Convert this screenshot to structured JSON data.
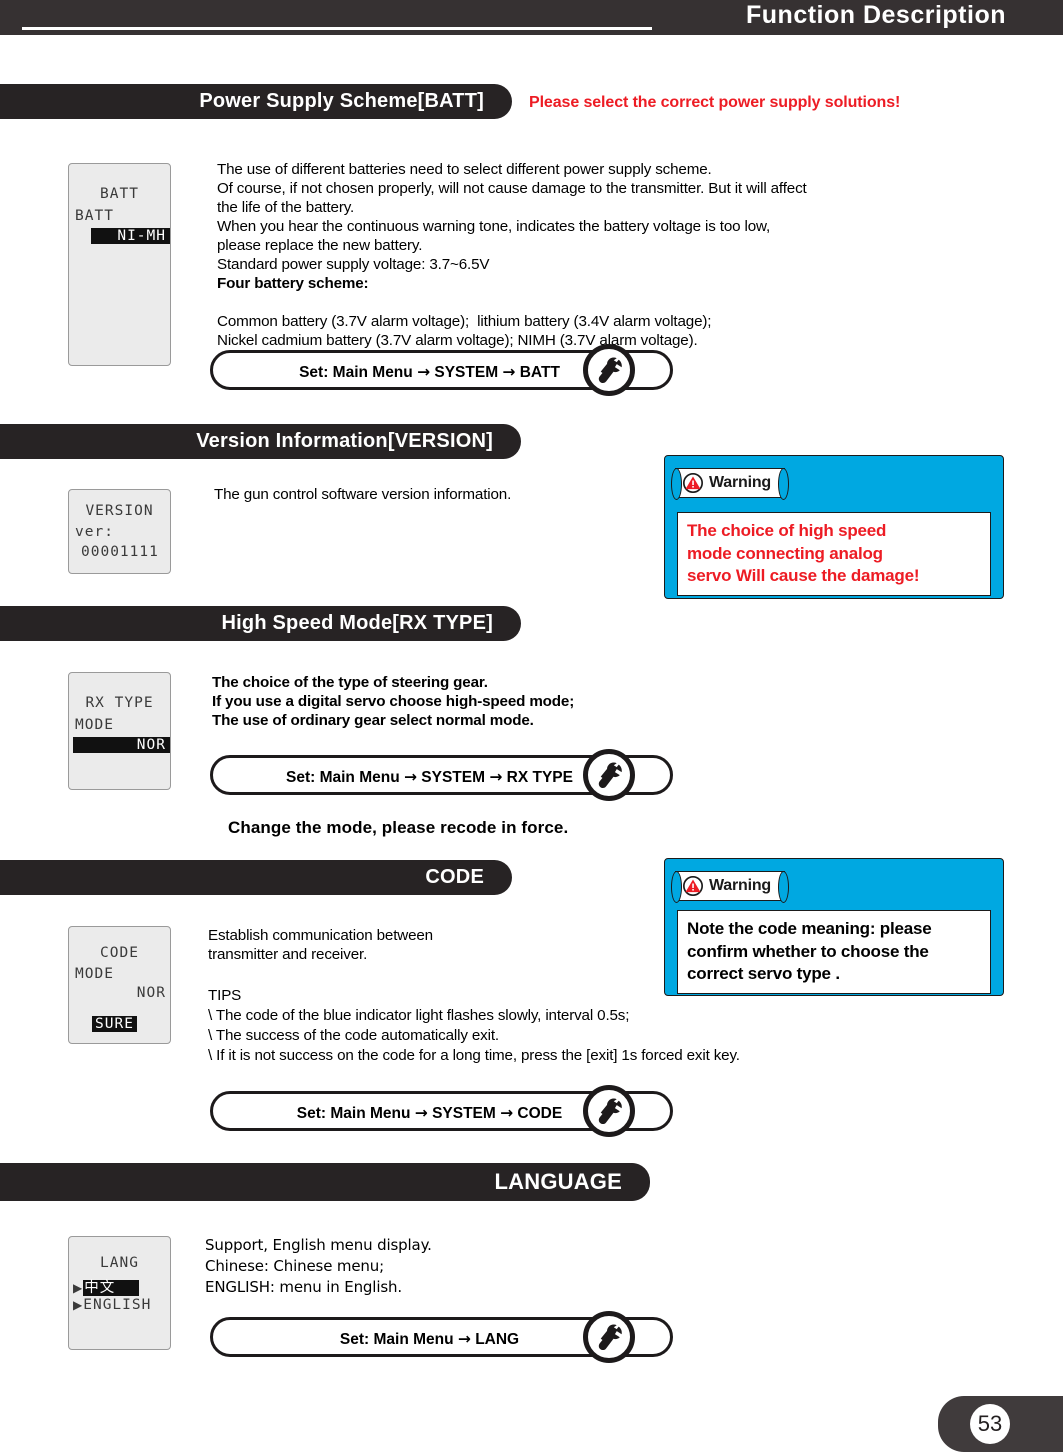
{
  "header": {
    "title": "Function Description"
  },
  "sections": {
    "batt": {
      "bar_label": "Power Supply Scheme[BATT]",
      "bar_note": "Please select the correct power supply solutions!",
      "lcd": {
        "title": "BATT",
        "line1": "BATT",
        "value": "NI-MH"
      },
      "body": [
        "The use of different batteries need to select different power supply scheme.",
        "Of course, if not chosen properly, will not cause damage to the transmitter. But it will affect",
        "the life of the battery.",
        "When you hear the continuous warning tone, indicates the battery voltage is too low,",
        "please replace the new battery.",
        "Standard power supply voltage: 3.7~6.5V"
      ],
      "body_bold": "Four battery scheme:",
      "body_tail": [
        "Common battery (3.7V alarm voltage);  lithium battery (3.4V alarm voltage);",
        "Nickel cadmium battery (3.7V alarm voltage); NIMH (3.7V alarm voltage)."
      ],
      "set_path": {
        "prefix": "Set: Main Menu",
        "mid": "SYSTEM",
        "target": "BATT",
        "arrow": "→"
      }
    },
    "version": {
      "bar_label": "Version Information[VERSION]",
      "lcd": {
        "title": "VERSION",
        "line1": "ver:",
        "line2": "00001111"
      },
      "body": [
        "The gun control software version information."
      ]
    },
    "rxtype": {
      "bar_label": "High Speed Mode[RX TYPE]",
      "lcd": {
        "title": "RX TYPE",
        "line1": "MODE",
        "value": "NOR"
      },
      "body": [
        "The choice of the type of steering gear.",
        "If you use a digital servo choose high-speed mode;",
        "The use of ordinary gear select normal mode."
      ],
      "set_path": {
        "prefix": "Set: Main Menu",
        "mid": "SYSTEM",
        "target": "RX TYPE",
        "arrow": "→"
      },
      "after_note": "Change the mode, please recode in force."
    },
    "code": {
      "bar_label": "CODE",
      "lcd": {
        "title": "CODE",
        "line1": "MODE",
        "line1_value": "NOR",
        "value": "SURE"
      },
      "body": [
        "Establish communication between",
        "transmitter and receiver."
      ],
      "tips_title": "TIPS",
      "tips": [
        "\\ The code of the blue indicator light flashes slowly, interval 0.5s;",
        "\\ The success of the code automatically exit.",
        "\\ If it is not success on the code for a long time, press the [exit] 1s forced exit key."
      ],
      "set_path": {
        "prefix": "Set: Main Menu",
        "mid": "SYSTEM",
        "target": "CODE",
        "arrow": "→"
      }
    },
    "language": {
      "bar_label": "LANGUAGE",
      "lcd": {
        "title": "LANG",
        "opt1": "中文",
        "opt2": "ENGLISH",
        "marker": "▶"
      },
      "body": [
        "Support, English menu display.",
        "Chinese: Chinese menu;",
        "ENGLISH: menu in English."
      ],
      "set_path": {
        "prefix": "Set: Main Menu",
        "target": "LANG",
        "arrow": "→"
      }
    }
  },
  "warnings": {
    "high_speed": {
      "label": "Warning",
      "lines": [
        "The choice of high speed",
        "mode connecting analog",
        "servo Will cause the damage!"
      ],
      "text_color": "#ED1C24",
      "box_color": "#00A8E1"
    },
    "code": {
      "label": "Warning",
      "lines": [
        "Note the code meaning: please",
        "confirm whether to choose the",
        "correct servo type ."
      ],
      "text_color": "#000000",
      "box_color": "#00A8E1"
    }
  },
  "footer": {
    "page_number": "53"
  }
}
